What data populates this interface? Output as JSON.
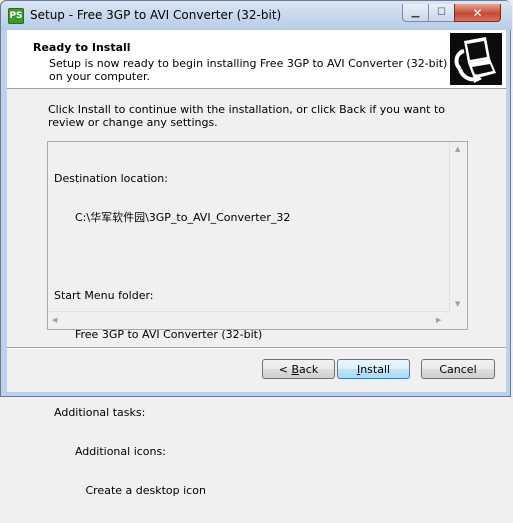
{
  "window": {
    "title": "Setup - Free 3GP to AVI Converter (32-bit)",
    "app_icon_text": "PS"
  },
  "header": {
    "title": "Ready to Install",
    "subtitle": "Setup is now ready to begin installing Free 3GP to AVI Converter (32-bit) on your computer."
  },
  "body": {
    "intro": "Click Install to continue with the installation, or click Back if you want to review or change any settings.",
    "memo": {
      "lines": [
        "Destination location:",
        "      C:\\华军软件园\\3GP_to_AVI_Converter_32",
        "",
        "Start Menu folder:",
        "      Free 3GP to AVI Converter (32-bit)",
        "",
        "Additional tasks:",
        "      Additional icons:",
        "         Create a desktop icon"
      ]
    }
  },
  "buttons": {
    "back_prefix": "< ",
    "back_hotkey": "B",
    "back_rest": "ack",
    "install_hotkey": "I",
    "install_rest": "nstall",
    "cancel": "Cancel"
  }
}
